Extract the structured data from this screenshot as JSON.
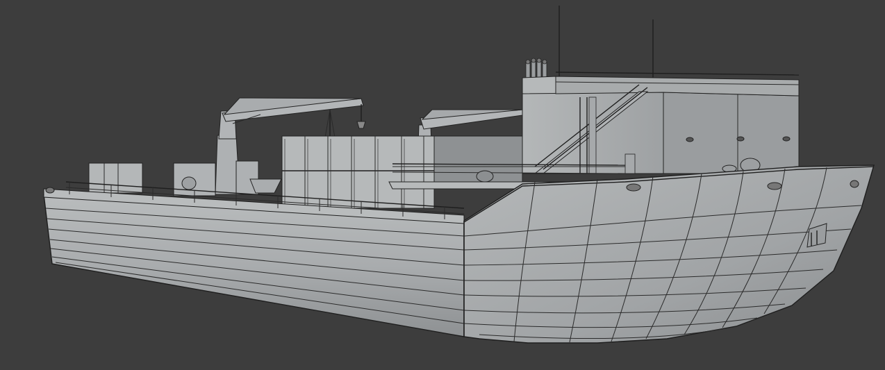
{
  "viewport": {
    "background": "#3d3d3d",
    "object": "ship-model",
    "shading": "solid-with-wireframe",
    "colors": {
      "hull_light": "#b4b7b8",
      "hull_mid": "#a3a6a8",
      "hull_dark": "#8f9294",
      "wire": "#2a2a2a"
    }
  }
}
